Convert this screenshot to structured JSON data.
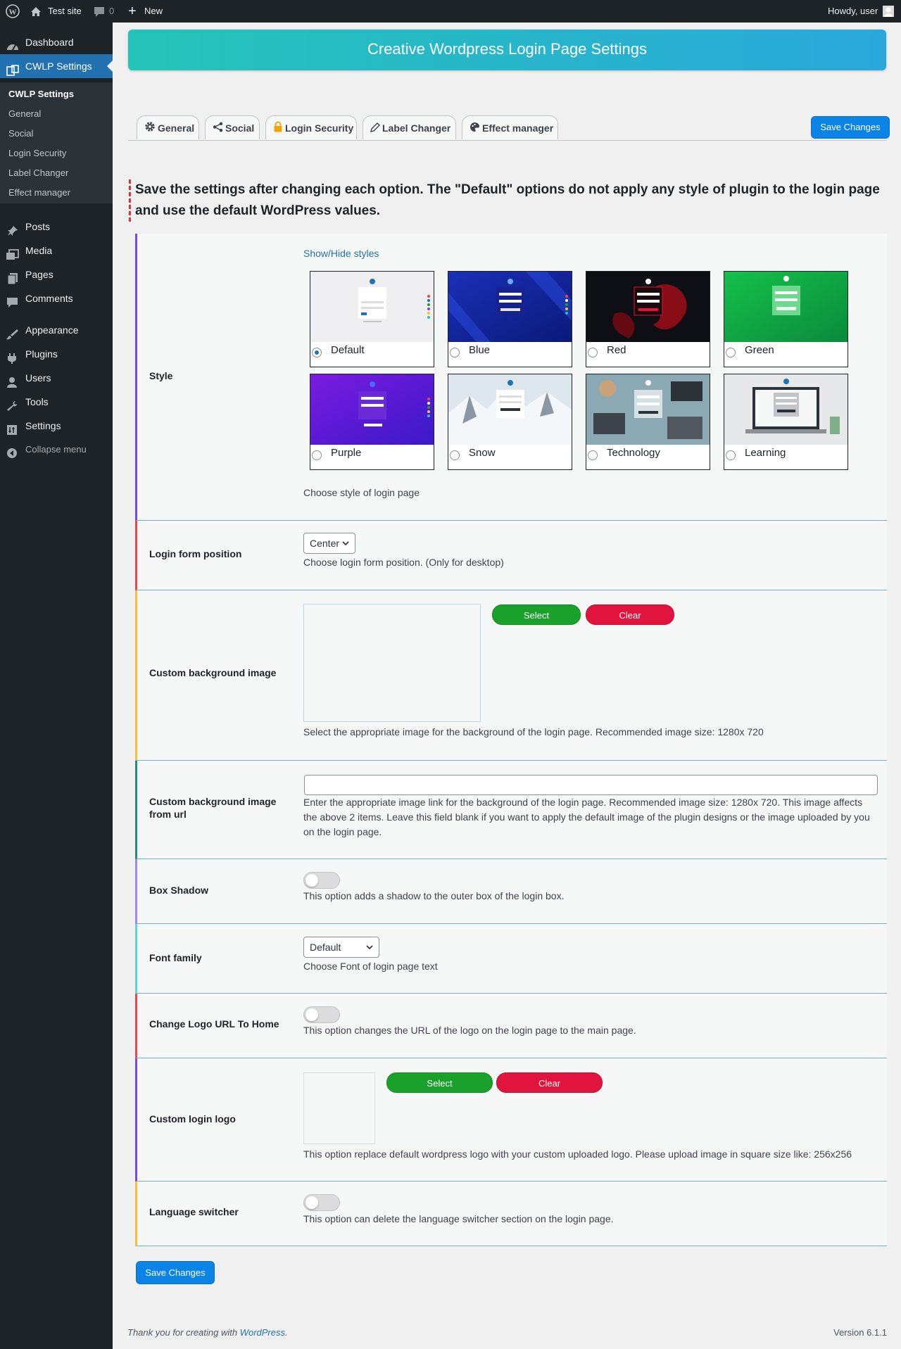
{
  "adminbar": {
    "site_name": "Test site",
    "comments_count": "0",
    "new_label": "New",
    "greeting": "Howdy, user"
  },
  "sidebar": {
    "items": [
      {
        "label": "Dashboard",
        "icon": "dashboard-icon"
      },
      {
        "label": "CWLP Settings",
        "icon": "cwlp-icon"
      },
      {
        "label": "Posts",
        "icon": "pin-icon"
      },
      {
        "label": "Media",
        "icon": "media-icon"
      },
      {
        "label": "Pages",
        "icon": "pages-icon"
      },
      {
        "label": "Comments",
        "icon": "comment-icon"
      },
      {
        "label": "Appearance",
        "icon": "brush-icon"
      },
      {
        "label": "Plugins",
        "icon": "plugin-icon"
      },
      {
        "label": "Users",
        "icon": "user-icon"
      },
      {
        "label": "Tools",
        "icon": "wrench-icon"
      },
      {
        "label": "Settings",
        "icon": "settings-icon"
      },
      {
        "label": "Collapse menu",
        "icon": "collapse-icon"
      }
    ],
    "submenu": [
      "CWLP Settings",
      "General",
      "Social",
      "Login Security",
      "Label Changer",
      "Effect manager"
    ]
  },
  "header": {
    "title": "Creative Wordpress Login Page Settings"
  },
  "tabs": [
    {
      "label": "General",
      "icon": "gear-icon"
    },
    {
      "label": "Social",
      "icon": "share-icon"
    },
    {
      "label": "Login Security",
      "icon": "lock-icon"
    },
    {
      "label": "Label Changer",
      "icon": "pencil-icon"
    },
    {
      "label": "Effect manager",
      "icon": "palette-icon"
    }
  ],
  "save_label": "Save Changes",
  "notice": "Save the settings after changing each option. The \"Default\" options do not apply any style of plugin to the login page and use the default WordPress values.",
  "style_section": {
    "label": "Style",
    "toggle_link": "Show/Hide styles",
    "options": [
      "Default",
      "Blue",
      "Red",
      "Green",
      "Purple",
      "Snow",
      "Technology",
      "Learning"
    ],
    "selected": "Default",
    "description": "Choose style of login page"
  },
  "login_form_position": {
    "label": "Login form position",
    "value": "Center",
    "description": "Choose login form position. (Only for desktop)"
  },
  "custom_bg_image": {
    "label": "Custom background image",
    "select_label": "Select",
    "clear_label": "Clear",
    "description": "Select the appropriate image for the background of the login page. Recommended image size: 1280x 720"
  },
  "custom_bg_url": {
    "label": "Custom background image from url",
    "value": "",
    "description": "Enter the appropriate image link for the background of the login page. Recommended image size: 1280x 720. This image affects the above 2 items. Leave this field blank if you want to apply the default image of the plugin designs or the image uploaded by you on the login page."
  },
  "box_shadow": {
    "label": "Box Shadow",
    "enabled": false,
    "description": "This option adds a shadow to the outer box of the login box."
  },
  "font_family": {
    "label": "Font family",
    "value": "Default",
    "description": "Choose Font of login page text"
  },
  "logo_url": {
    "label": "Change Logo URL To Home",
    "enabled": false,
    "description": "This option changes the URL of the logo on the login page to the main page."
  },
  "custom_logo": {
    "label": "Custom login logo",
    "select_label": "Select",
    "clear_label": "Clear",
    "description": "This option replace default wordpress logo with your custom uploaded logo. Please upload image in square size like: 256x256"
  },
  "language_switcher": {
    "label": "Language switcher",
    "enabled": false,
    "description": "This option can delete the language switcher section on the login page."
  },
  "footer": {
    "thanks_prefix": "Thank you for creating with ",
    "thanks_link": "WordPress",
    "thanks_suffix": ".",
    "version": "Version 6.1.1"
  },
  "colors": {
    "admin_dark": "#1d2327",
    "admin_blue": "#2271b1",
    "banner_start": "#25c4b8",
    "banner_end": "#2aa8dc",
    "select_green": "#1aa12c",
    "clear_red": "#e0143c",
    "row_borders": [
      "#7b4ad8",
      "#e04a4a",
      "#f2c230",
      "#1d8f7f",
      "#a08be0",
      "#5cd6d6",
      "#e04a4a",
      "#7b4ad8",
      "#f2c230"
    ]
  }
}
